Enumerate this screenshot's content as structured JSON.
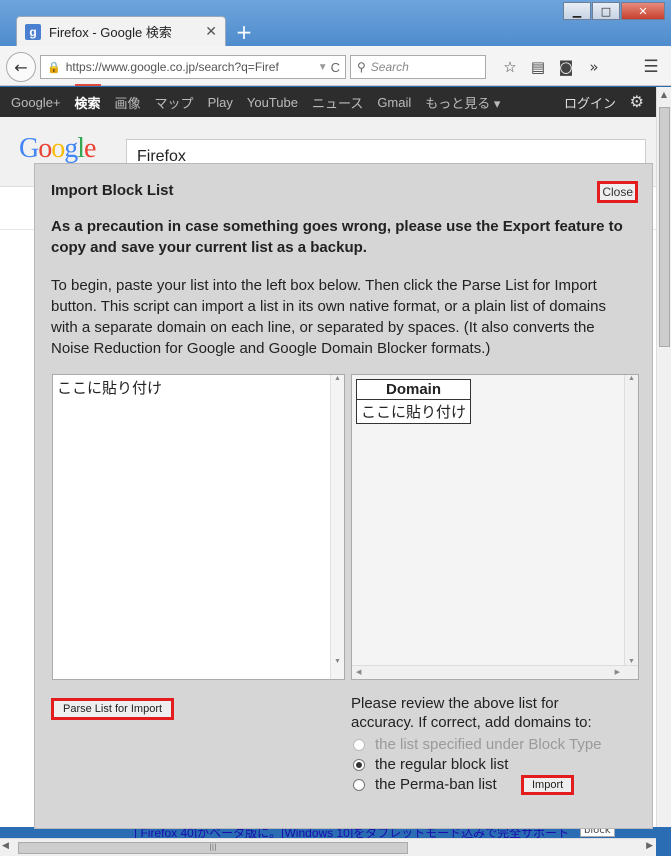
{
  "browser": {
    "tab_title": "Firefox - Google 検索",
    "tab_favicon": "g",
    "url": "https://www.google.co.jp/search?q=Firef",
    "search_placeholder": "Search"
  },
  "google_bar": {
    "items": [
      "Google+",
      "検索",
      "画像",
      "マップ",
      "Play",
      "YouTube",
      "ニュース",
      "Gmail",
      "もっと見る ▾"
    ],
    "active_index": 1,
    "login": "ログイン"
  },
  "google": {
    "logo": "Google",
    "query": "Firefox"
  },
  "dialog": {
    "title": "Import Block List",
    "close_label": "Close",
    "warning": "As a precaution in case something goes wrong, please use the Export feature to copy and save your current list as a backup.",
    "intro": "To begin, paste your list into the left box below. Then click the Parse List for Import button. This script can import a list in its own native format, or a plain list of domains with a separate domain on each line, or separated by spaces. (It also converts the Noise Reduction for Google and Google Domain Blocker formats.)",
    "paste_value": "ここに貼り付け",
    "domain_header": "Domain",
    "domain_rows": [
      "ここに貼り付け"
    ],
    "parse_button": "Parse List for Import",
    "review_text": "Please review the above list for accuracy. If correct, add domains to:",
    "options": [
      {
        "label": "the list specified under Block Type",
        "checked": false,
        "disabled": true
      },
      {
        "label": "the regular block list",
        "checked": true,
        "disabled": false
      },
      {
        "label": "the Perma-ban list",
        "checked": false,
        "disabled": false
      }
    ],
    "import_button": "Import"
  },
  "bottom_result": {
    "text": "| Firefox 40]がベータ版に。[Windows 10]をタブレットモード込みで完全サポート",
    "tag": "block"
  },
  "colors": {
    "highlight_red": "#e31d1d",
    "google_bar": "#2d2d2d",
    "dialog_bg": "#d6d6d6"
  }
}
